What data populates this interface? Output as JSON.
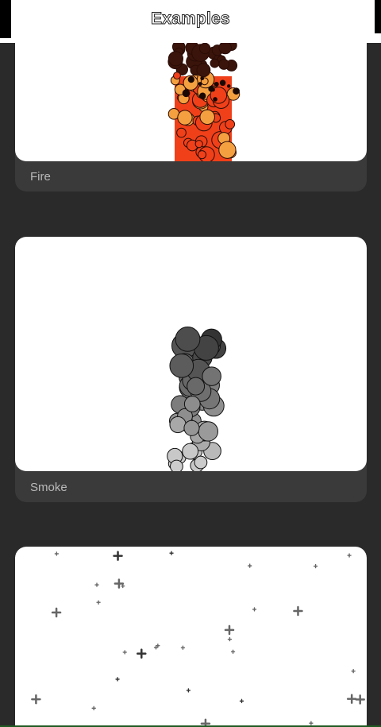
{
  "header": {
    "title": "Examples"
  },
  "examples": [
    {
      "label": "Fire"
    },
    {
      "label": "Smoke"
    },
    {
      "label": ""
    }
  ],
  "colors": {
    "background": "#2a2a2a",
    "card_footer": "#3a3a3a",
    "canvas": "#ffffff",
    "label": "#b9b9b9",
    "fire_core": "#f0401a",
    "fire_glow": "#f4a040",
    "fire_edge": "#3a140a",
    "smoke_dark": "#2e2e2e",
    "smoke_light": "#d0d0d0"
  }
}
